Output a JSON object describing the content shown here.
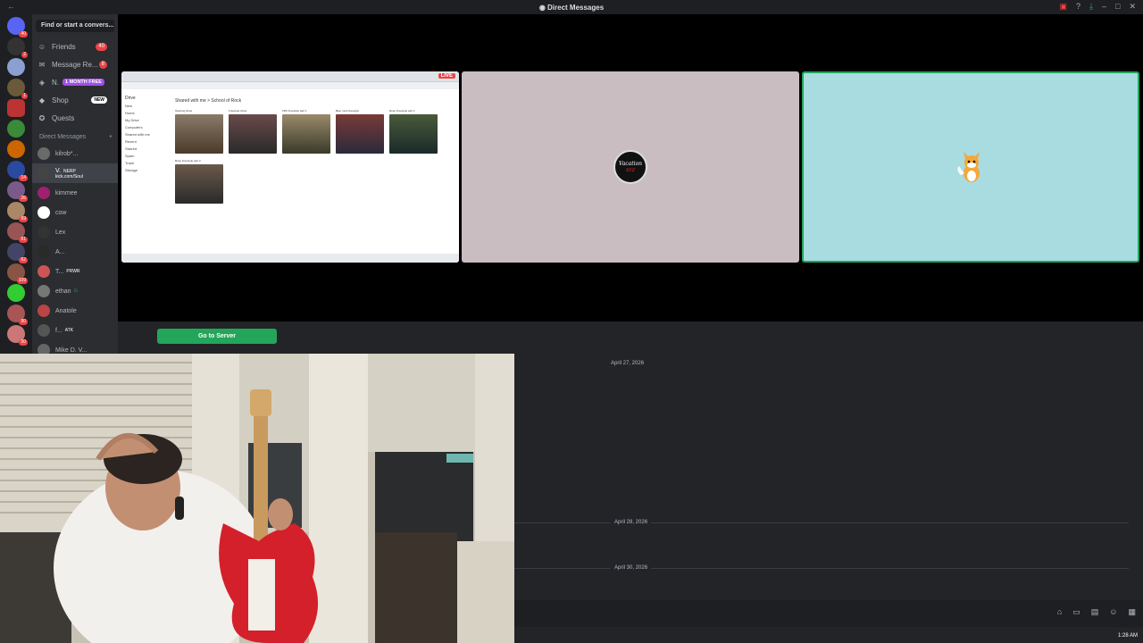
{
  "window": {
    "title": "Direct Messages"
  },
  "search": {
    "placeholder": "Find or start a convers..."
  },
  "nav": {
    "friends": {
      "label": "Friends",
      "badge": "40"
    },
    "requests": {
      "label": "Message Re...",
      "badge": "8"
    },
    "nitro": {
      "label": "N.",
      "promo": "1 MONTH FREE"
    },
    "shop": {
      "label": "Shop",
      "badge": "NEW"
    },
    "quests": {
      "label": "Quests"
    }
  },
  "dm_header": {
    "label": "Direct Messages",
    "add": "+"
  },
  "dms": [
    {
      "name": "kilrob*..."
    },
    {
      "name": "V.",
      "tag": "NERP",
      "sub": "kick.com/Soul"
    },
    {
      "name": "kimmee"
    },
    {
      "name": "cow"
    },
    {
      "name": "Lex"
    },
    {
      "name": "A..."
    },
    {
      "name": "T...",
      "tag": "PRWR"
    },
    {
      "name": "ethan"
    },
    {
      "name": "Anatole"
    },
    {
      "name": "f...",
      "tag": "ATK"
    },
    {
      "name": "Mike D. V..."
    }
  ],
  "server_badges": [
    "40",
    "2",
    "1",
    "14",
    "26",
    "69",
    "61",
    "62",
    "109",
    "90",
    "50"
  ],
  "stream": {
    "live": "LIVE",
    "drive": {
      "app": "Drive",
      "breadcrumb": "Shared with me  >  School of Rock",
      "files": [
        "Opening show",
        "Freestyle show",
        "Fifth Freestyle part 1",
        "Beer next Freestyle",
        "Rose Freestyle part 1",
        "Rose Freestyle part 2"
      ],
      "sidebar": [
        "New",
        "Home",
        "My Drive",
        "Computers",
        "Shared with me",
        "Recent",
        "Starred",
        "Spam",
        "Trash",
        "Storage"
      ]
    },
    "vacation_avatar": {
      "line1": "Vacation",
      "line2": "XYZ"
    }
  },
  "chat": {
    "go_server": "Go to Server",
    "dates": [
      "April 27, 2026",
      "April 28, 2026",
      "April 30, 2026"
    ],
    "clock": "1:28 AM"
  },
  "colors": {
    "accent": "#23a55a",
    "badge": "#ed4245",
    "bg_dark": "#1e1f22",
    "sidebar": "#2b2d31",
    "nitro": "#a14ee6"
  },
  "icons": [
    "back-icon",
    "discord-icon",
    "gift-icon",
    "help-icon",
    "download-icon",
    "minimize-icon",
    "maximize-icon",
    "close-icon",
    "friends-icon",
    "mail-icon",
    "nitro-icon",
    "shop-icon",
    "quests-icon",
    "plus-icon"
  ]
}
